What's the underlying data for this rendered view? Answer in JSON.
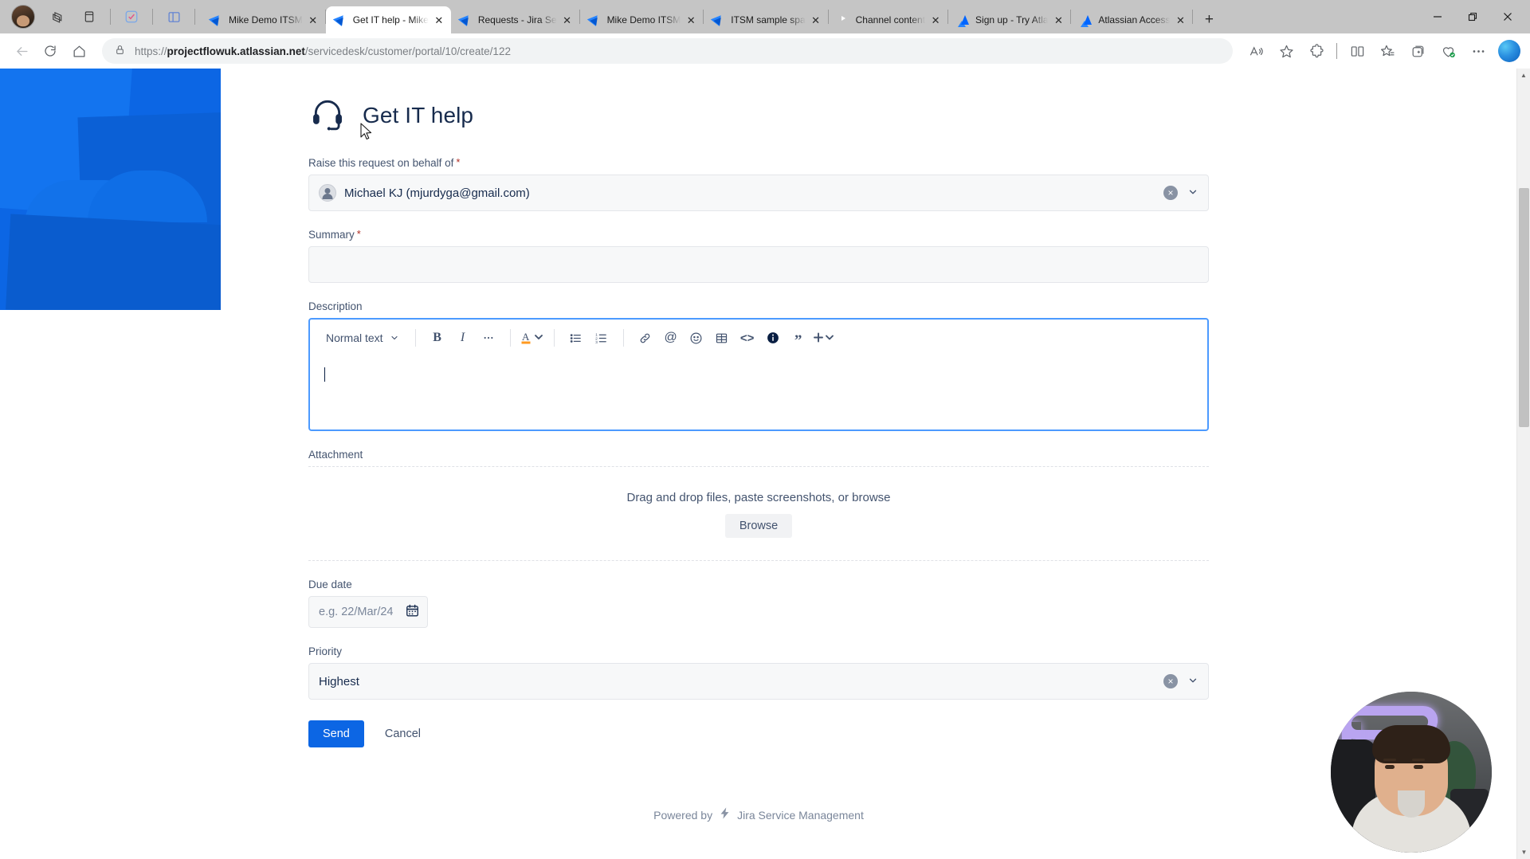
{
  "browser": {
    "tabs": [
      {
        "title": "Mike Demo ITSM",
        "favicon": "jira-icon",
        "active": false
      },
      {
        "title": "Get IT help - Mike",
        "favicon": "jira-icon",
        "active": true
      },
      {
        "title": "Requests - Jira Se",
        "favicon": "jira-icon",
        "active": false
      },
      {
        "title": "Mike Demo ITSM",
        "favicon": "jira-icon",
        "active": false
      },
      {
        "title": "ITSM sample spa",
        "favicon": "jira-icon",
        "active": false
      },
      {
        "title": "Channel content",
        "favicon": "youtube-icon",
        "active": false
      },
      {
        "title": "Sign up - Try Atla",
        "favicon": "atlassian-icon",
        "active": false
      },
      {
        "title": "Atlassian Access",
        "favicon": "atlassian-icon",
        "active": false
      }
    ],
    "new_tab_label": "+",
    "close_label": "✕",
    "window_controls": {
      "minimize": "–",
      "maximize": "❐",
      "close": "✕"
    },
    "left_icons": [
      "profile-avatar",
      "copilot-pane-icon",
      "vertical-tabs-icon",
      "todo-icon",
      "split-screen-icon"
    ],
    "address": {
      "scheme": "https://",
      "domain": "projectflowuk.atlassian.net",
      "path": "/servicedesk/customer/portal/10/create/122",
      "full_url": "https://projectflowuk.atlassian.net/servicedesk/customer/portal/10/create/122",
      "lock_icon": "lock-icon"
    },
    "nav": {
      "back": "back-icon",
      "refresh": "refresh-icon",
      "home": "home-icon"
    },
    "right_icons": [
      "read-aloud-icon",
      "favorite-star-icon",
      "extensions-icon",
      "split-screen-icon",
      "collections-icon",
      "add-tab-group-icon",
      "browser-essentials-icon",
      "settings-more-icon",
      "copilot-icon"
    ]
  },
  "page": {
    "request_title": "Get IT help",
    "request_icon": "headset-icon",
    "fields": {
      "raise_on_behalf": {
        "label": "Raise this request on behalf of",
        "required": true,
        "required_mark": "*",
        "value": "Michael KJ (mjurdyga@gmail.com)",
        "clear_icon": "clear-icon",
        "chevron_icon": "chevron-down-icon"
      },
      "summary": {
        "label": "Summary",
        "required": true,
        "required_mark": "*",
        "value": ""
      },
      "description": {
        "label": "Description",
        "required": false,
        "value": "",
        "toolbar": {
          "text_style": "Normal text",
          "style_chevron": "chevron-down-icon",
          "bold": "B",
          "italic": "I",
          "more_formatting": "···",
          "text_color": "A",
          "color_chevron": "chevron-down-icon",
          "bullet_list": "bullet-list-icon",
          "numbered_list": "numbered-list-icon",
          "link": "link-icon",
          "mention": "@",
          "emoji": "emoji-icon",
          "table": "table-icon",
          "code": "<>",
          "info_panel": "info-panel-icon",
          "quote": "”",
          "insert_more": "+",
          "insert_chevron": "chevron-down-icon"
        }
      },
      "attachment": {
        "label": "Attachment",
        "drop_text": "Drag and drop files, paste screenshots, or browse",
        "browse_label": "Browse"
      },
      "due_date": {
        "label": "Due date",
        "placeholder": "e.g. 22/Mar/24",
        "value": "",
        "calendar_icon": "calendar-icon"
      },
      "priority": {
        "label": "Priority",
        "value": "Highest",
        "clear_icon": "clear-icon",
        "chevron_icon": "chevron-down-icon"
      }
    },
    "actions": {
      "send_label": "Send",
      "cancel_label": "Cancel"
    },
    "footer": {
      "powered_by": "Powered by",
      "product": "Jira Service Management",
      "bolt_icon": "jsm-bolt-icon"
    }
  },
  "overlay": {
    "webcam": "webcam-video-circle"
  },
  "colors": {
    "brand_blue": "#0c66e4",
    "banner_blue": "#0c66e4",
    "field_bg": "#f7f8f9",
    "label_text": "#44546f",
    "title_text": "#172b4d",
    "required_red": "#ae2e24",
    "focus_border": "#4c9aff",
    "tabstrip": "#c5c5c5"
  }
}
